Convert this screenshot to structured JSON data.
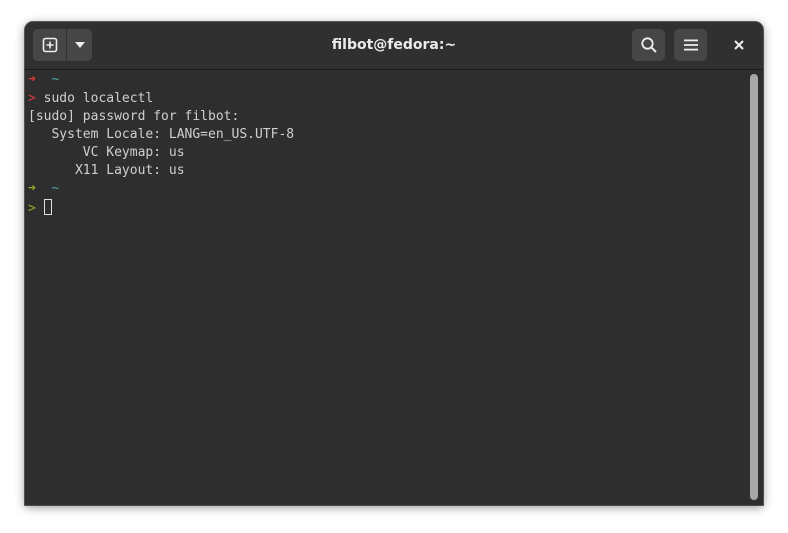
{
  "window": {
    "title": "filbot@fedora:~"
  },
  "headerbar": {
    "new_tab_icon": "plus-square-icon",
    "dropdown_icon": "chevron-down-icon",
    "search_icon": "search-icon",
    "menu_icon": "hamburger-menu-icon",
    "close_icon": "close-icon"
  },
  "terminal": {
    "lines": [
      {
        "arrow": "➜",
        "dir": "~"
      },
      {
        "prompt": ">",
        "text": " sudo localectl"
      },
      {
        "text": "[sudo] password for filbot:"
      },
      {
        "text": "   System Locale: LANG=en_US.UTF-8"
      },
      {
        "text": "       VC Keymap: us"
      },
      {
        "text": "      X11 Layout: us"
      },
      {
        "arrow": "➜",
        "dir": "~"
      },
      {
        "prompt": ">",
        "text": " "
      }
    ],
    "colors": {
      "error_arrow": "#d83a3a",
      "ok_arrow": "#8fac2b",
      "dir": "#4aa3a3",
      "background": "#2e2e2e"
    }
  }
}
